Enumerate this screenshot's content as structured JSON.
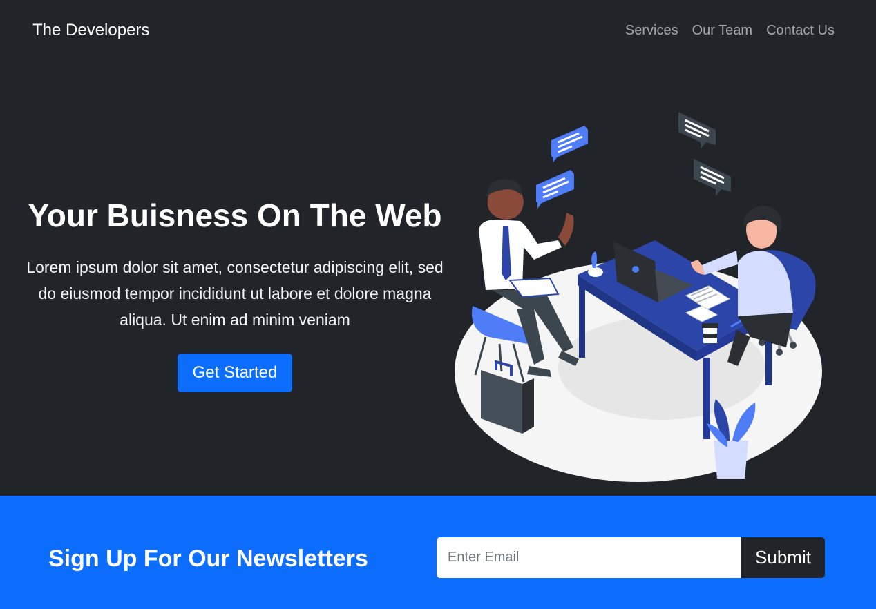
{
  "navbar": {
    "brand": "The Developers",
    "links": [
      {
        "label": "Services"
      },
      {
        "label": "Our Team"
      },
      {
        "label": "Contact Us"
      }
    ]
  },
  "hero": {
    "title": "Your Buisness On The Web",
    "lead": "Lorem ipsum dolor sit amet, consectetur adipiscing elit, sed do eiusmod tempor incididunt ut labore et dolore magna aliqua. Ut enim ad minim veniam",
    "cta_label": "Get Started"
  },
  "newsletter": {
    "title": "Sign Up For Our Newsletters",
    "email_placeholder": "Enter Email",
    "email_value": "",
    "submit_label": "Submit"
  },
  "colors": {
    "background": "#212529",
    "primary": "#0d6efd",
    "accent_dark_blue": "#2b46a8",
    "white": "#ffffff"
  },
  "illustration": {
    "subject": "business-meeting-illustration"
  }
}
